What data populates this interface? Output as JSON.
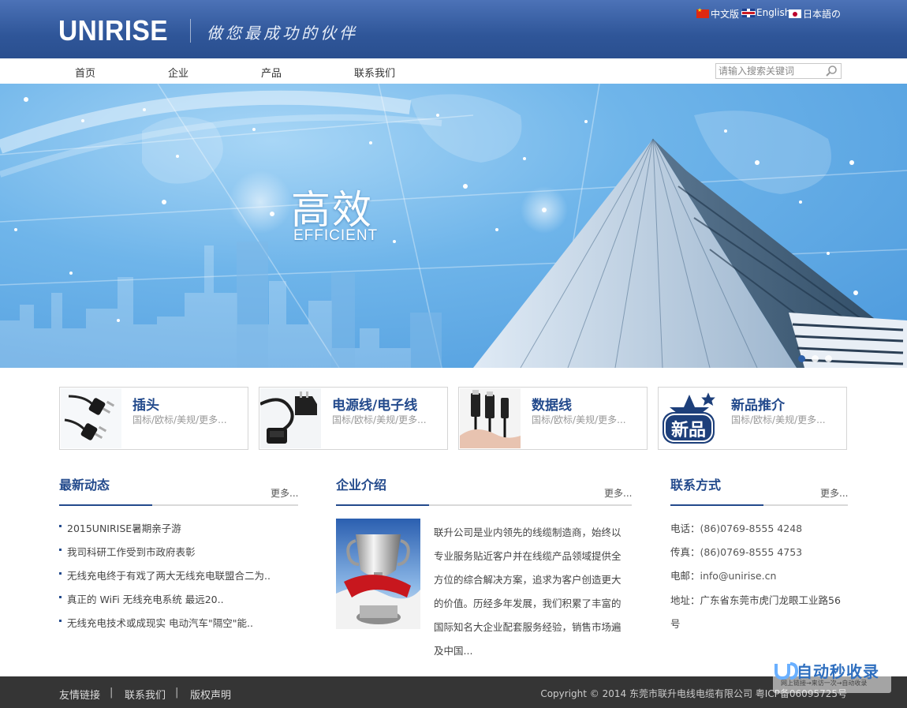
{
  "header": {
    "logo": "UNIRISE",
    "slogan": "做您最成功的伙伴",
    "languages": [
      {
        "label": "中文版",
        "flag": "cn-flag-icon"
      },
      {
        "label": "English",
        "flag": "uk-flag-icon"
      },
      {
        "label": "日本語の",
        "flag": "jp-flag-icon"
      }
    ]
  },
  "nav": {
    "items": [
      "首页",
      "企业",
      "产品",
      "联系我们"
    ],
    "search_placeholder": "请输入搜索关键词"
  },
  "banner": {
    "title": "高效",
    "subtitle": "EFFICIENT",
    "slides": 3,
    "active_slide": 1
  },
  "products": [
    {
      "title": "插头",
      "desc": "国标/欧标/美规/更多..."
    },
    {
      "title": "电源线/电子线",
      "desc": "国标/欧标/美规/更多..."
    },
    {
      "title": "数据线",
      "desc": "国标/欧标/美规/更多..."
    },
    {
      "title": "新品推介",
      "desc": "国标/欧标/美规/更多..."
    }
  ],
  "news": {
    "title": "最新动态",
    "more": "更多...",
    "items": [
      "2015UNIRISE暑期亲子游",
      "我司科研工作受到市政府表彰",
      "无线充电终于有戏了两大无线充电联盟合二为..",
      "真正的 WiFi 无线充电系统 最远20..",
      "无线充电技术或成现实 电动汽车\"隔空\"能.."
    ]
  },
  "about": {
    "title": "企业介绍",
    "more": "更多...",
    "text": "联升公司是业内领先的线缆制造商，始终以专业服务贴近客户并在线缆产品领域提供全方位的综合解决方案，追求为客户创造更大的价值。历经多年发展，我们积累了丰富的国际知名大企业配套服务经验，销售市场遍及中国..."
  },
  "contact": {
    "title": "联系方式",
    "more": "更多...",
    "phone_label": "电话：",
    "phone": "(86)0769-8555 4248",
    "fax_label": "传真：",
    "fax": "(86)0769-8555 4753",
    "email_label": "电邮：",
    "email": "info@unirise.cn",
    "address_label": "地址：",
    "address": "广东省东莞市虎门龙眼工业路56号"
  },
  "footer": {
    "links": [
      "友情链接",
      "联系我们",
      "版权声明"
    ],
    "separator": "|",
    "copyright": "Copyright © 2014 东莞市联升电线电缆有限公司 粤ICP备06095725号"
  },
  "watermark": {
    "text": "自动秒收录",
    "sub": "网上链接→来访一次→自动收录"
  },
  "colors": {
    "header_blue": "#2f5699",
    "title_blue": "#234a8c",
    "footer_bg": "#353535"
  }
}
